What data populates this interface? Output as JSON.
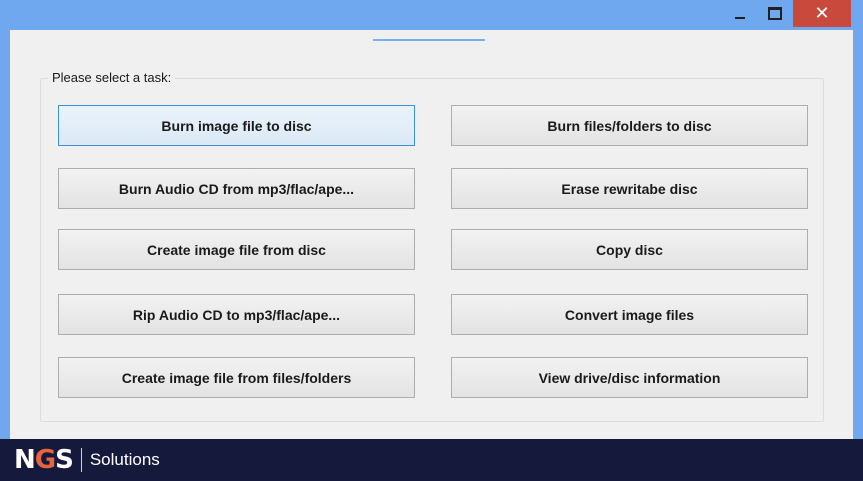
{
  "window": {
    "controls": {
      "minimize_icon": "minimize-icon",
      "maximize_icon": "maximize-icon",
      "close_icon": "close-icon",
      "close_glyph": "✕"
    },
    "colors": {
      "titlebar": "#6fa8ee",
      "close": "#c94a3c",
      "footer": "#151a3d",
      "accent": "#e8643c"
    }
  },
  "group": {
    "label": "Please select a task:"
  },
  "tasks": {
    "left": [
      "Burn image file to disc",
      "Burn Audio CD from mp3/flac/ape...",
      "Create image file from disc",
      "Rip Audio CD to mp3/flac/ape...",
      "Create image file from files/folders"
    ],
    "right": [
      "Burn files/folders to disc",
      "Erase rewritabe disc",
      "Copy disc",
      "Convert image files",
      "View drive/disc information"
    ]
  },
  "footer": {
    "logo_text_1": "N",
    "logo_text_2": "G",
    "logo_text_3": "S",
    "logo_subtitle": "Solutions"
  }
}
